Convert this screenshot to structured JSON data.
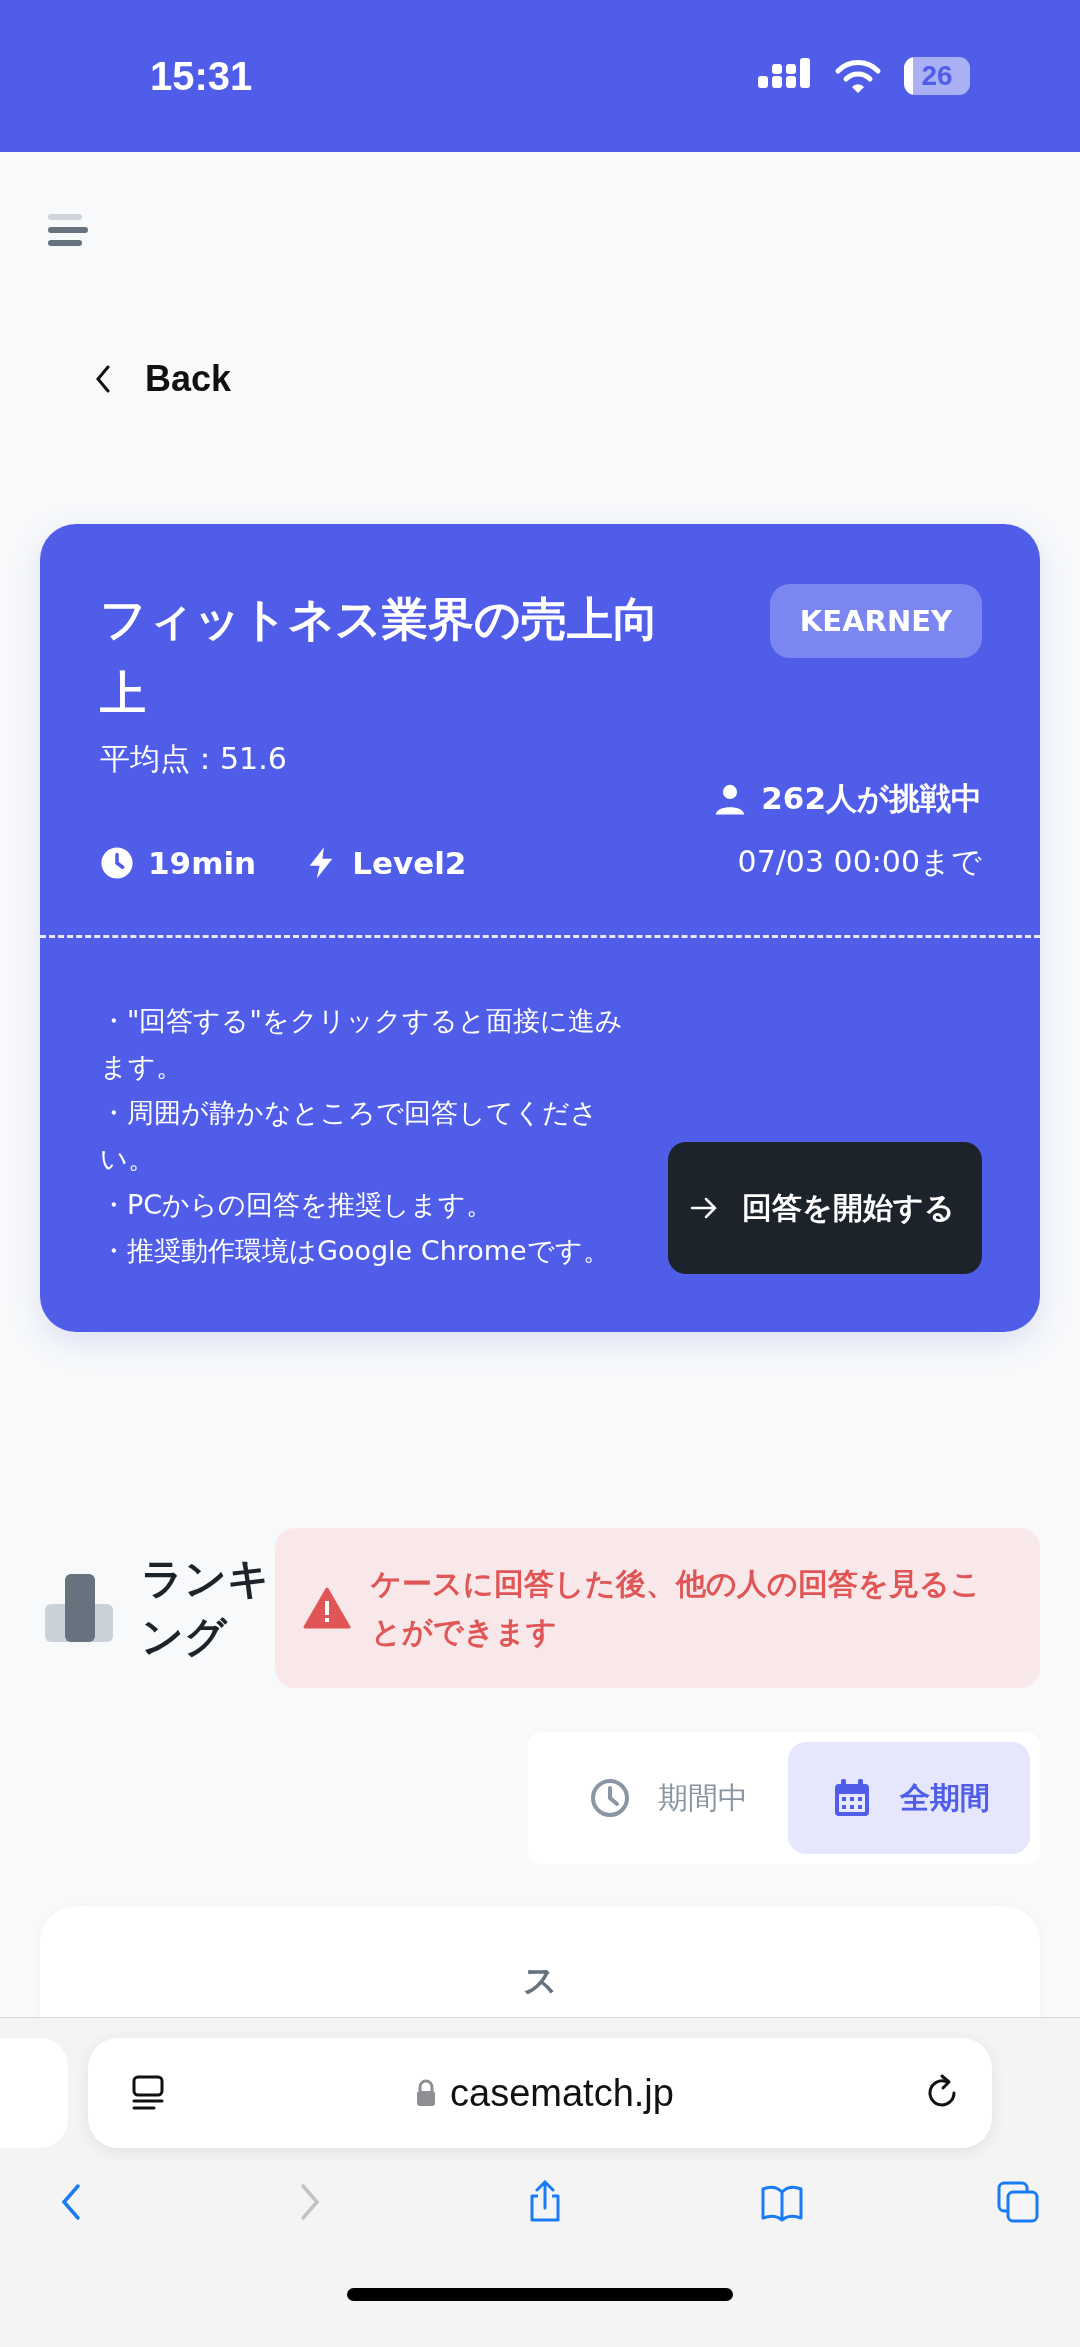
{
  "status_bar": {
    "time": "15:31",
    "battery": "26"
  },
  "back": {
    "label": "Back"
  },
  "case_card": {
    "title": "フィットネス業界の売上向上",
    "company": "KEARNEY",
    "average": "平均点：51.6",
    "challengers": "262人が挑戦中",
    "duration": "19min",
    "level_label": "Level2",
    "deadline": "07/03 00:00まで",
    "notes": [
      "・\"回答する\"をクリックすると面接に進みます。",
      "・周囲が静かなところで回答してください。",
      "・PCからの回答を推奨します。",
      "・推奨動作環境はGoogle Chromeです。"
    ],
    "start_button": "回答を開始する"
  },
  "ranking": {
    "title": "ランキング",
    "notice": "ケースに回答した後、他の人の回答を見ることができます",
    "period_tabs": [
      {
        "label": "期間中",
        "kind": "clock",
        "selected": false
      },
      {
        "label": "全期間",
        "kind": "calendar",
        "selected": true
      }
    ],
    "card_text": "ス"
  },
  "browser": {
    "url": "casematch.jp",
    "toolbar": [
      {
        "kind": "back",
        "disabled": false
      },
      {
        "kind": "forward",
        "disabled": true
      },
      {
        "kind": "share",
        "disabled": false
      },
      {
        "kind": "bookmarks",
        "disabled": false
      },
      {
        "kind": "tabs",
        "disabled": false
      }
    ]
  }
}
